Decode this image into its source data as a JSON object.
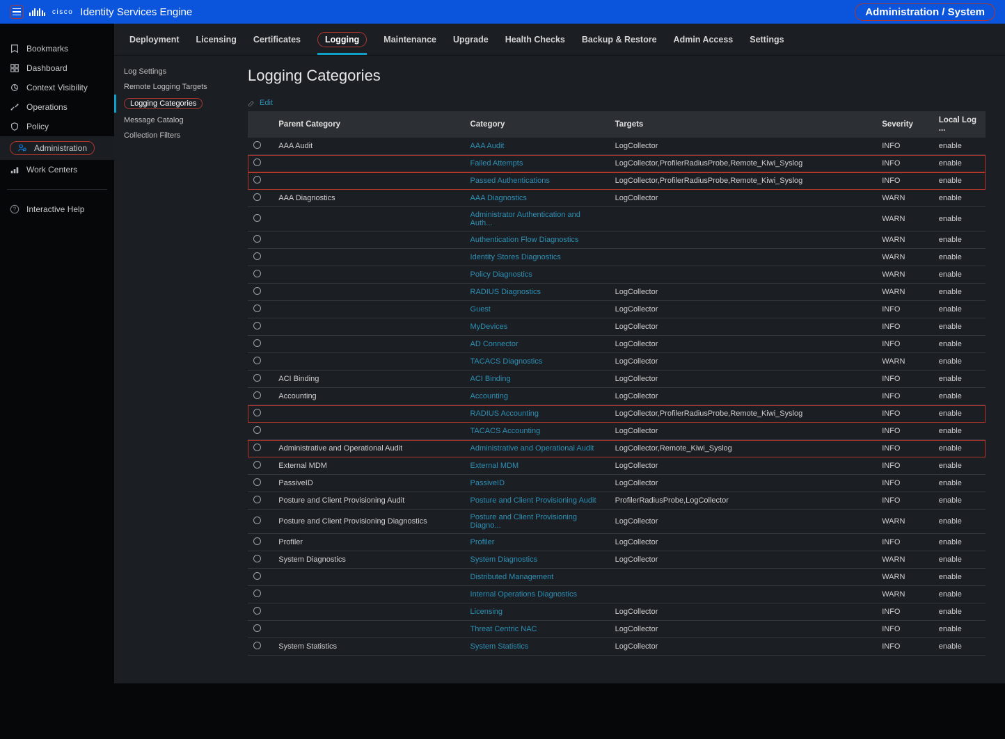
{
  "header": {
    "product": "Identity Services Engine",
    "breadcrumb": "Administration / System",
    "brand": "cisco"
  },
  "leftnav": [
    {
      "label": "Bookmarks"
    },
    {
      "label": "Dashboard"
    },
    {
      "label": "Context Visibility"
    },
    {
      "label": "Operations"
    },
    {
      "label": "Policy"
    },
    {
      "label": "Administration",
      "active": true
    },
    {
      "label": "Work Centers"
    }
  ],
  "help": {
    "label": "Interactive Help"
  },
  "tabs": [
    "Deployment",
    "Licensing",
    "Certificates",
    "Logging",
    "Maintenance",
    "Upgrade",
    "Health Checks",
    "Backup & Restore",
    "Admin Access",
    "Settings"
  ],
  "activeTab": "Logging",
  "sidenav": [
    "Log Settings",
    "Remote Logging Targets",
    "Logging Categories",
    "Message Catalog",
    "Collection Filters"
  ],
  "activeSide": "Logging Categories",
  "page": {
    "title": "Logging Categories",
    "edit": "Edit"
  },
  "cols": {
    "r": "",
    "parent": "Parent Category",
    "cat": "Category",
    "tgt": "Targets",
    "sev": "Severity",
    "log": "Local Log ..."
  },
  "rows": [
    {
      "p": "AAA Audit",
      "c": "AAA Audit",
      "t": "LogCollector",
      "s": "INFO",
      "l": "enable"
    },
    {
      "p": "",
      "c": "Failed Attempts",
      "t": "LogCollector,ProfilerRadiusProbe,Remote_Kiwi_Syslog",
      "s": "INFO",
      "l": "enable",
      "hl": true
    },
    {
      "p": "",
      "c": "Passed Authentications",
      "t": "LogCollector,ProfilerRadiusProbe,Remote_Kiwi_Syslog",
      "s": "INFO",
      "l": "enable",
      "hl": true
    },
    {
      "p": "AAA Diagnostics",
      "c": "AAA Diagnostics",
      "t": "LogCollector",
      "s": "WARN",
      "l": "enable"
    },
    {
      "p": "",
      "c": "Administrator Authentication and Auth...",
      "t": "",
      "s": "WARN",
      "l": "enable"
    },
    {
      "p": "",
      "c": "Authentication Flow Diagnostics",
      "t": "",
      "s": "WARN",
      "l": "enable"
    },
    {
      "p": "",
      "c": "Identity Stores Diagnostics",
      "t": "",
      "s": "WARN",
      "l": "enable"
    },
    {
      "p": "",
      "c": "Policy Diagnostics",
      "t": "",
      "s": "WARN",
      "l": "enable"
    },
    {
      "p": "",
      "c": "RADIUS Diagnostics",
      "t": "LogCollector",
      "s": "WARN",
      "l": "enable"
    },
    {
      "p": "",
      "c": "Guest",
      "t": "LogCollector",
      "s": "INFO",
      "l": "enable"
    },
    {
      "p": "",
      "c": "MyDevices",
      "t": "LogCollector",
      "s": "INFO",
      "l": "enable"
    },
    {
      "p": "",
      "c": "AD Connector",
      "t": "LogCollector",
      "s": "INFO",
      "l": "enable"
    },
    {
      "p": "",
      "c": "TACACS Diagnostics",
      "t": "LogCollector",
      "s": "WARN",
      "l": "enable"
    },
    {
      "p": "ACI Binding",
      "c": "ACI Binding",
      "t": "LogCollector",
      "s": "INFO",
      "l": "enable"
    },
    {
      "p": "Accounting",
      "c": "Accounting",
      "t": "LogCollector",
      "s": "INFO",
      "l": "enable"
    },
    {
      "p": "",
      "c": "RADIUS Accounting",
      "t": "LogCollector,ProfilerRadiusProbe,Remote_Kiwi_Syslog",
      "s": "INFO",
      "l": "enable",
      "hl": true
    },
    {
      "p": "",
      "c": "TACACS Accounting",
      "t": "LogCollector",
      "s": "INFO",
      "l": "enable"
    },
    {
      "p": "Administrative and Operational Audit",
      "c": "Administrative and Operational Audit",
      "t": "LogCollector,Remote_Kiwi_Syslog",
      "s": "INFO",
      "l": "enable",
      "hl": true
    },
    {
      "p": "External MDM",
      "c": "External MDM",
      "t": "LogCollector",
      "s": "INFO",
      "l": "enable"
    },
    {
      "p": "PassiveID",
      "c": "PassiveID",
      "t": "LogCollector",
      "s": "INFO",
      "l": "enable"
    },
    {
      "p": "Posture and Client Provisioning Audit",
      "c": "Posture and Client Provisioning Audit",
      "t": "ProfilerRadiusProbe,LogCollector",
      "s": "INFO",
      "l": "enable"
    },
    {
      "p": "Posture and Client Provisioning Diagnostics",
      "c": "Posture and Client Provisioning Diagno...",
      "t": "LogCollector",
      "s": "WARN",
      "l": "enable"
    },
    {
      "p": "Profiler",
      "c": "Profiler",
      "t": "LogCollector",
      "s": "INFO",
      "l": "enable"
    },
    {
      "p": "System Diagnostics",
      "c": "System Diagnostics",
      "t": "LogCollector",
      "s": "WARN",
      "l": "enable"
    },
    {
      "p": "",
      "c": "Distributed Management",
      "t": "",
      "s": "WARN",
      "l": "enable"
    },
    {
      "p": "",
      "c": "Internal Operations Diagnostics",
      "t": "",
      "s": "WARN",
      "l": "enable"
    },
    {
      "p": "",
      "c": "Licensing",
      "t": "LogCollector",
      "s": "INFO",
      "l": "enable"
    },
    {
      "p": "",
      "c": "Threat Centric NAC",
      "t": "LogCollector",
      "s": "INFO",
      "l": "enable"
    },
    {
      "p": "System Statistics",
      "c": "System Statistics",
      "t": "LogCollector",
      "s": "INFO",
      "l": "enable"
    }
  ]
}
